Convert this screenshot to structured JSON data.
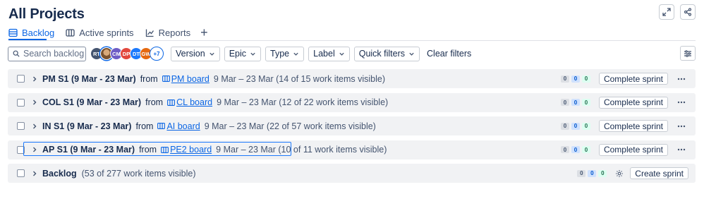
{
  "page": {
    "title": "All Projects"
  },
  "tabs": [
    {
      "label": "Backlog",
      "icon": "list-icon",
      "active": true
    },
    {
      "label": "Active sprints",
      "icon": "board-icon",
      "active": false
    },
    {
      "label": "Reports",
      "icon": "chart-icon",
      "active": false
    }
  ],
  "toolbar": {
    "search_placeholder": "Search backlog",
    "avatars": [
      {
        "initials": "RT",
        "color": "#44546f"
      },
      {
        "initials": "",
        "color": "#7a5230"
      },
      {
        "initials": "CM",
        "color": "#6e5dc6"
      },
      {
        "initials": "DP",
        "color": "#e2483d"
      },
      {
        "initials": "DT",
        "color": "#1d7afc"
      },
      {
        "initials": "GW",
        "color": "#e56910"
      }
    ],
    "more_avatars": "+7",
    "filters": [
      "Version",
      "Epic",
      "Type",
      "Label",
      "Quick filters"
    ],
    "clear_label": "Clear filters"
  },
  "sprints": [
    {
      "name": "PM S1 (9 Mar - 23 Mar)",
      "from": "from",
      "board": "PM board",
      "dates": "9 Mar – 23 Mar (14 of 15 work items visible)",
      "todo": "0",
      "in_progress": "0",
      "done": "0",
      "action": "Complete sprint"
    },
    {
      "name": "COL S1 (9 Mar - 23 Mar)",
      "from": "from",
      "board": "CL board",
      "dates": "9 Mar – 23 Mar (12 of 22 work items visible)",
      "todo": "0",
      "in_progress": "0",
      "done": "0",
      "action": "Complete sprint"
    },
    {
      "name": "IN S1 (9 Mar - 23 Mar)",
      "from": "from",
      "board": "AI board",
      "dates": "9 Mar – 23 Mar (22 of 57 work items visible)",
      "todo": "0",
      "in_progress": "0",
      "done": "0",
      "action": "Complete sprint"
    },
    {
      "name": "AP S1 (9 Mar - 23 Mar)",
      "from": "from",
      "board": "PE2 board",
      "dates": "9 Mar – 23 Mar (10 of 11 work items visible)",
      "todo": "0",
      "in_progress": "0",
      "done": "0",
      "action": "Complete sprint"
    }
  ],
  "backlog": {
    "name": "Backlog",
    "count": "(53 of 277 work items visible)",
    "todo": "0",
    "in_progress": "0",
    "done": "0",
    "action": "Create sprint"
  },
  "colors": {
    "accent": "#0c66e4",
    "row_bg": "#f1f2f4",
    "focus": "#1d7afc"
  }
}
